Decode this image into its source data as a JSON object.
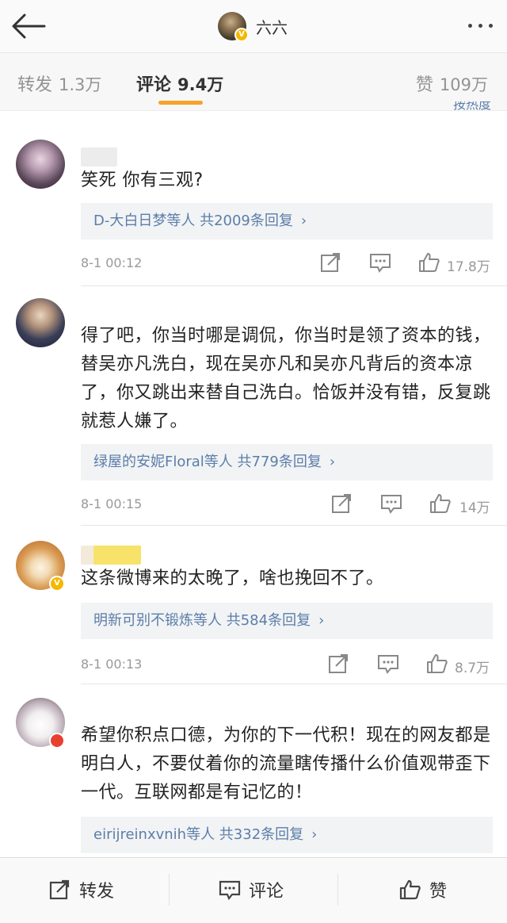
{
  "header": {
    "back_icon": "back-arrow-icon",
    "username": "六六",
    "verified": "V",
    "more_icon": "more-dots-icon"
  },
  "tabs": [
    {
      "label": "转发",
      "count": "1.3万"
    },
    {
      "label": "评论",
      "count": "9.4万"
    },
    {
      "label": "赞",
      "count": "109万"
    }
  ],
  "sort_peek": "按热度",
  "comments": [
    {
      "text": "笑死 你有三观?",
      "replies": "D-大白日梦等人 共2009条回复",
      "time": "8-1 00:12",
      "likes": "17.8万"
    },
    {
      "text": "得了吧，你当时哪是调侃，你当时是领了资本的钱，替吴亦凡洗白，现在吴亦凡和吴亦凡背后的资本凉了，你又跳出来替自己洗白。恰饭并没有错，反复跳就惹人嫌了。",
      "replies": "绿屋的安妮Floral等人 共779条回复",
      "time": "8-1 00:15",
      "likes": "14万"
    },
    {
      "text": "这条微博来的太晚了，啥也挽回不了。",
      "replies": "明新可别不锻炼等人 共584条回复",
      "time": "8-1 00:13",
      "likes": "8.7万"
    },
    {
      "text": "希望你积点口德，为你的下一代积！现在的网友都是明白人，不要仗着你的流量瞎传播什么价值观带歪下一代。互联网都是有记忆的！",
      "replies": "eirijreinxvnih等人 共332条回复"
    }
  ],
  "reply_arrow": "›",
  "bottom": {
    "repost": "转发",
    "comment": "评论",
    "like": "赞"
  },
  "colors": {
    "accent": "#f7a12a",
    "link": "#5b7ea9",
    "verified": "#f5b700"
  }
}
